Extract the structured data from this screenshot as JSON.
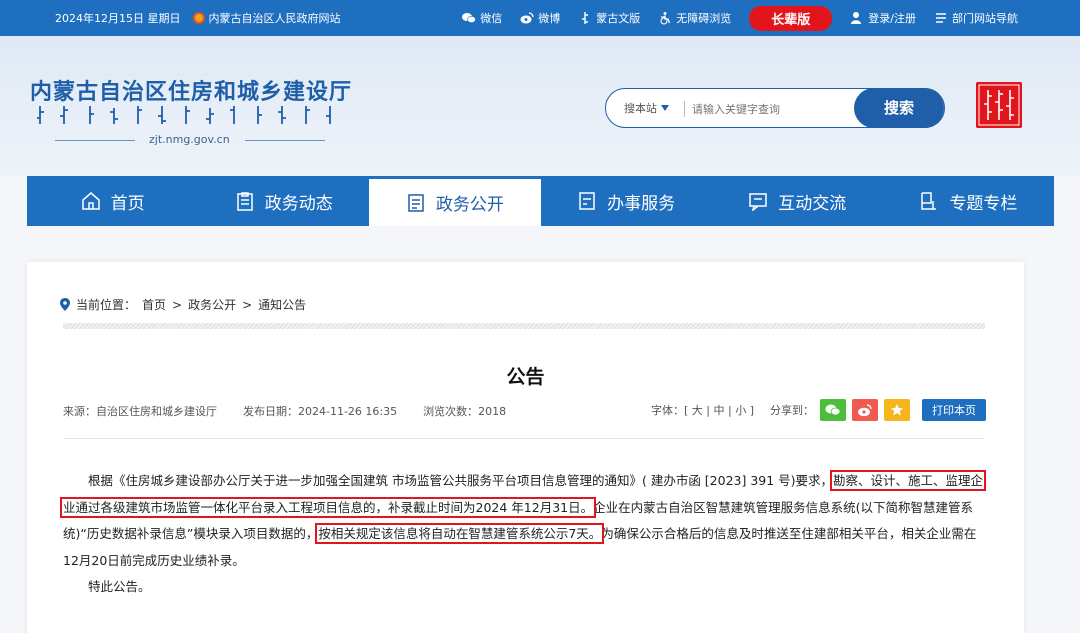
{
  "topbar": {
    "date": "2024年12月15日 星期日",
    "gov_link": "内蒙古自治区人民政府网站",
    "wechat": "微信",
    "weibo": "微博",
    "mongolian": "蒙古文版",
    "accessible": "无障碍浏览",
    "elder": "长辈版",
    "login": "登录/注册",
    "dept_nav": "部门网站导航"
  },
  "header": {
    "title": "内蒙古自治区住房和城乡建设厅",
    "domain": "zjt.nmg.gov.cn"
  },
  "search": {
    "scope": "搜本站",
    "placeholder": "请输入关键字查询",
    "button": "搜索"
  },
  "nav": {
    "tabs": [
      {
        "label": "首页",
        "icon": "home-icon"
      },
      {
        "label": "政务动态",
        "icon": "clipboard-icon"
      },
      {
        "label": "政务公开",
        "icon": "document-icon"
      },
      {
        "label": "办事服务",
        "icon": "service-icon"
      },
      {
        "label": "互动交流",
        "icon": "chat-icon"
      },
      {
        "label": "专题专栏",
        "icon": "topic-icon"
      }
    ],
    "active_index": 2
  },
  "breadcrumb": {
    "prefix": "当前位置：",
    "items": [
      "首页",
      ">",
      "政务公开",
      ">",
      "通知公告"
    ]
  },
  "article": {
    "title": "公告",
    "source": "来源：自治区住房和城乡建设厅",
    "date": "发布日期：2024-11-26 16:35",
    "views": "浏览次数：2018",
    "font_label": "字体：[ 大 | 中 | 小 ]",
    "share_label": "分享到：",
    "print": "打印本页",
    "p1_a": "根据《住房城乡建设部办公厅关于进一步加强全国建筑 市场监管公共服务平台项目信息管理的通知》( 建办市函 [2023] 391 号)要求，",
    "p1_hl1": "勘察、设计、施工、监理企业通过各级建筑市场监管一体化平台录入工程项目信息的，补录截止时间为2024 年12月31日。",
    "p1_b": "企业在内蒙古自治区智慧建筑管理服务信息系统(以下简称智慧建管系统)“历史数据补录信息”模块录入项目数据的，",
    "p1_hl2": "按相关规定该信息将自动在智慧建管系统公示7天。",
    "p1_c": "为确保公示合格后的信息及时推送至住建部相关平台，相关企业需在12月20日前完成历史业绩补录。",
    "p2": "特此公告。"
  },
  "colors": {
    "brand_blue": "#1f6fc0",
    "accent_red": "#e3151c",
    "wechat_green": "#4cbf3a",
    "weibo_red": "#f05a4f",
    "fav_yellow": "#f5b51b"
  }
}
